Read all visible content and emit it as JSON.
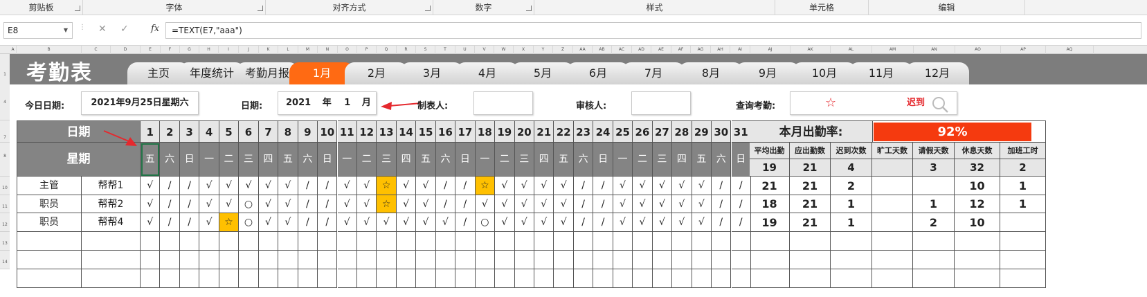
{
  "ribbon": {
    "groups": [
      "剪贴板",
      "字体",
      "对齐方式",
      "数字",
      "样式",
      "单元格",
      "编辑"
    ]
  },
  "formula": {
    "cell_ref": "E8",
    "content": "=TEXT(E7,\"aaa\")",
    "fx": "fx"
  },
  "columns": [
    "A",
    "B",
    "C",
    "D",
    "E",
    "F",
    "G",
    "H",
    "I",
    "J",
    "K",
    "L",
    "M",
    "N",
    "O",
    "P",
    "Q",
    "R",
    "S",
    "T",
    "U",
    "V",
    "W",
    "X",
    "Y",
    "Z",
    "AA",
    "AB",
    "AC",
    "AD",
    "AE",
    "AF",
    "AG",
    "AH",
    "AI",
    "AJ",
    "AK",
    "AL",
    "AM",
    "AN",
    "AO",
    "AP",
    "AQ"
  ],
  "rows": [
    "1",
    "4",
    "7",
    "8",
    "10",
    "11",
    "12",
    "13",
    "14"
  ],
  "sheet": {
    "title": "考勤表",
    "tabs": [
      "主页",
      "年度统计",
      "考勤月报",
      "1月",
      "2月",
      "3月",
      "4月",
      "5月",
      "6月",
      "7月",
      "8月",
      "9月",
      "10月",
      "11月",
      "12月"
    ],
    "active_tab": "1月",
    "today_label": "今日日期:",
    "today_value": "2021年9月25日星期六",
    "date_label": "日期:",
    "year": "2021",
    "year_unit": "年",
    "month": "1",
    "month_unit": "月",
    "maker_label": "制表人:",
    "reviewer_label": "审核人:",
    "query_label": "查询考勤:",
    "query_symbol": "☆",
    "query_text": "迟到",
    "accent": "#ff6a13",
    "rate_color": "#f53a0f",
    "highlight": "#ffc000"
  },
  "grid": {
    "date_label": "日期",
    "week_label": "星期",
    "days": [
      "1",
      "2",
      "3",
      "4",
      "5",
      "6",
      "7",
      "8",
      "9",
      "10",
      "11",
      "12",
      "13",
      "14",
      "15",
      "16",
      "17",
      "18",
      "19",
      "20",
      "21",
      "22",
      "23",
      "24",
      "25",
      "26",
      "27",
      "28",
      "29",
      "30",
      "31"
    ],
    "weekdays": [
      "五",
      "六",
      "日",
      "一",
      "二",
      "三",
      "四",
      "五",
      "六",
      "日",
      "一",
      "二",
      "三",
      "四",
      "五",
      "六",
      "日",
      "一",
      "二",
      "三",
      "四",
      "五",
      "六",
      "日",
      "一",
      "二",
      "三",
      "四",
      "五",
      "六",
      "日"
    ],
    "rate_label": "本月出勤率:",
    "rate_value": "92%",
    "stat_headers": [
      "平均出勤",
      "应出勤数",
      "迟到次数",
      "旷工天数",
      "请假天数",
      "休息天数",
      "加班工时"
    ],
    "stat_totals": [
      "19",
      "21",
      "4",
      "",
      "3",
      "32",
      "2"
    ],
    "employees": [
      {
        "role": "主管",
        "name": "帮帮1",
        "marks": [
          "√",
          "/",
          "/",
          "√",
          "√",
          "√",
          "√",
          "√",
          "/",
          "/",
          "√",
          "√",
          "☆",
          "√",
          "√",
          "/",
          "/",
          "☆",
          "√",
          "√",
          "√",
          "√",
          "/",
          "/",
          "√",
          "√",
          "√",
          "√",
          "√",
          "/",
          "/"
        ],
        "stats": [
          "21",
          "21",
          "2",
          "",
          "",
          "10",
          "1"
        ]
      },
      {
        "role": "职员",
        "name": "帮帮2",
        "marks": [
          "√",
          "/",
          "/",
          "√",
          "√",
          "○",
          "√",
          "√",
          "/",
          "/",
          "√",
          "√",
          "☆",
          "√",
          "√",
          "/",
          "/",
          "√",
          "√",
          "√",
          "√",
          "√",
          "/",
          "/",
          "√",
          "√",
          "√",
          "√",
          "√",
          "/",
          "/"
        ],
        "stats": [
          "18",
          "21",
          "1",
          "",
          "1",
          "12",
          "1"
        ]
      },
      {
        "role": "职员",
        "name": "帮帮4",
        "marks": [
          "√",
          "/",
          "/",
          "√",
          "☆",
          "○",
          "√",
          "√",
          "/",
          "/",
          "√",
          "√",
          "√",
          "√",
          "√",
          "√",
          "/",
          "○",
          "√",
          "√",
          "√",
          "√",
          "/",
          "/",
          "√",
          "√",
          "√",
          "√",
          "√",
          "/",
          "/"
        ],
        "stats": [
          "19",
          "21",
          "1",
          "",
          "2",
          "10",
          ""
        ]
      }
    ]
  }
}
